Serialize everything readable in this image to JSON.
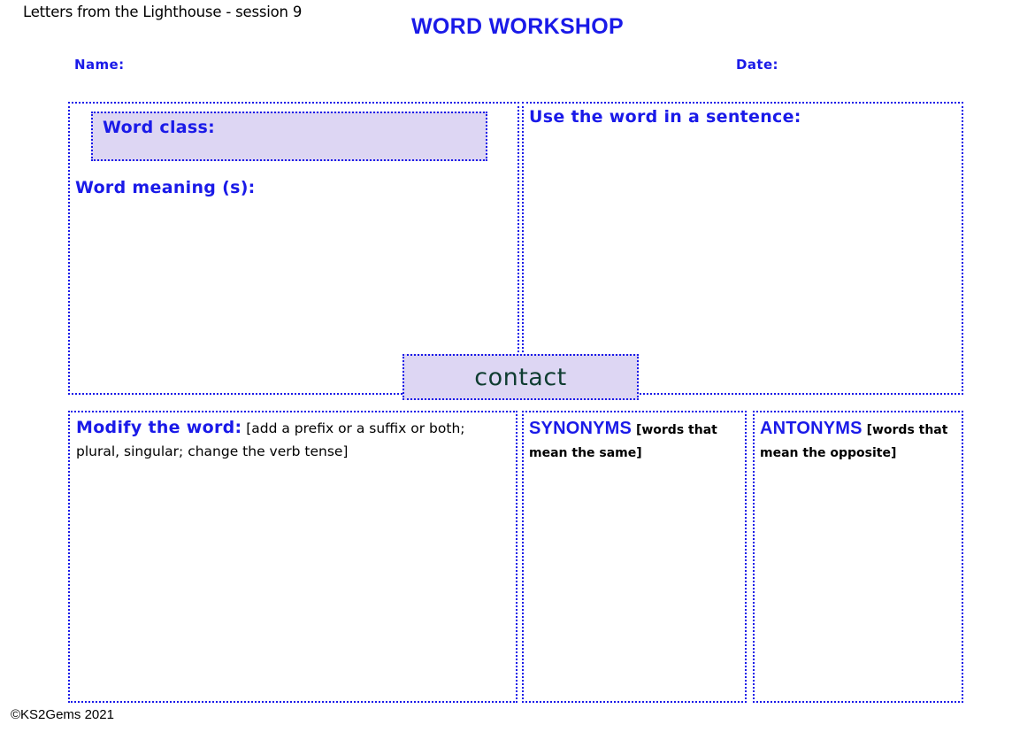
{
  "header": {
    "session_label": "Letters from the Lighthouse - session 9",
    "title": "WORD WORKSHOP",
    "name_label": "Name:",
    "date_label": "Date:"
  },
  "focus_word": "contact",
  "panels": {
    "word_class_label": "Word class:",
    "word_meaning_label": "Word meaning (s):",
    "sentence_label": "Use the word in a sentence:",
    "modify": {
      "accent_label": "Modify the word:",
      "note": "[add a prefix or a suffix or both; plural, singular; change the verb tense]"
    },
    "synonyms": {
      "accent_label": "SYNONYMS",
      "note": "[words that mean the same]"
    },
    "antonyms": {
      "accent_label": "ANTONYMS",
      "note": "[words that mean the opposite]"
    }
  },
  "footer": {
    "credit": "©KS2Gems 2021"
  },
  "colors": {
    "accent_blue": "#1a1ae8",
    "highlight_fill": "#ddd6f3",
    "word_text": "#0f3d31"
  }
}
